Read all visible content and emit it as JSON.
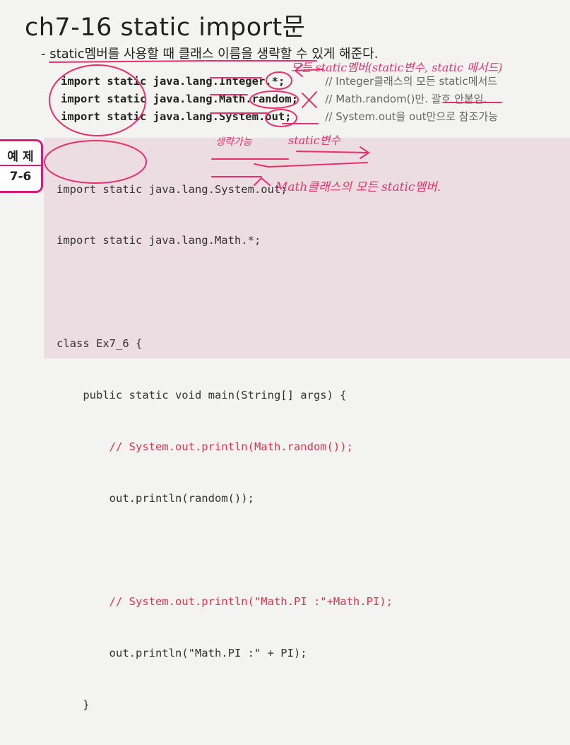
{
  "slide": {
    "title": "ch7-16 static import문",
    "subtitle": "- static멤버를 사용할 때 클래스 이름을 생략할 수 있게 해준다."
  },
  "imports": [
    {
      "code": "import static java.lang.Integer.*;",
      "comment": "// Integer클래스의 모든 static메서드"
    },
    {
      "code": "import static java.lang.Math.random;",
      "comment": "// Math.random()만. 괄호 안붙임."
    },
    {
      "code": "import static java.lang.System.out;",
      "comment": "// System.out을 out만으로 참조가능"
    }
  ],
  "example": {
    "badge_label": "예 제",
    "badge_number": "7-6",
    "code_lines": [
      {
        "text": "import static java.lang.System.out;",
        "type": "code"
      },
      {
        "text": "import static java.lang.Math.*;",
        "type": "code"
      },
      {
        "text": "",
        "type": "blank"
      },
      {
        "text": "class Ex7_6 {",
        "type": "code"
      },
      {
        "text": "    public static void main(String[] args) {",
        "type": "code"
      },
      {
        "text": "        // System.out.println(Math.random());",
        "type": "comment"
      },
      {
        "text": "        out.println(random());",
        "type": "code"
      },
      {
        "text": "",
        "type": "blank"
      },
      {
        "text": "        // System.out.println(\"Math.PI :\"+Math.PI);",
        "type": "comment"
      },
      {
        "text": "        out.println(\"Math.PI :\" + PI);",
        "type": "code"
      },
      {
        "text": "    }",
        "type": "code"
      },
      {
        "text": "}",
        "type": "code"
      }
    ]
  },
  "annotations": {
    "note_all_static": "모든 static멤버(static변수, static 메서드)",
    "note_omit": "생략가능",
    "note_static_var": "static변수",
    "note_math_members": "Math클래스의 모든 static멤버.",
    "color": "#e9306a"
  }
}
